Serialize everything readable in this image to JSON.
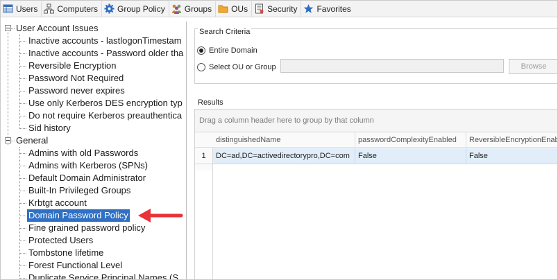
{
  "toolbar": {
    "items": [
      {
        "label": "Users",
        "icon": "users-grid-icon"
      },
      {
        "label": "Computers",
        "icon": "computers-network-icon"
      },
      {
        "label": "Group Policy",
        "icon": "gear-icon"
      },
      {
        "label": "Groups",
        "icon": "groups-icon"
      },
      {
        "label": "OUs",
        "icon": "folder-icon"
      },
      {
        "label": "Security",
        "icon": "document-icon"
      },
      {
        "label": "Favorites",
        "icon": "star-icon"
      }
    ]
  },
  "tree": {
    "groups": [
      {
        "label": "User Account Issues",
        "children": [
          "Inactive accounts - lastlogonTimestam",
          "Inactive accounts - Password older tha",
          "Reversible Encryption",
          "Password Not Required",
          "Password never expires",
          "Use only Kerberos DES encryption typ",
          "Do not require Kerberos preauthentica",
          "Sid history"
        ]
      },
      {
        "label": "General",
        "children": [
          "Admins with old Passwords",
          "Admins with Kerberos (SPNs)",
          "Default Domain Administrator",
          "Built-In Privileged Groups",
          "Krbtgt account",
          "Domain Password Policy",
          "Fine grained password policy",
          "Protected Users",
          "Tombstone lifetime",
          "Forest Functional Level",
          "Duplicate Service Principal Names (S"
        ]
      }
    ],
    "selected": "Domain Password Policy"
  },
  "search_criteria": {
    "title": "Search Criteria",
    "option_entire_domain": "Entire Domain",
    "option_select_ou": "Select OU or Group",
    "selected_option": "Entire Domain",
    "ou_value": "",
    "browse_label": "Browse"
  },
  "results": {
    "title": "Results",
    "drag_hint": "Drag a column header here to group by that column",
    "columns": [
      "distinguishedName",
      "passwordComplexityEnabled",
      "ReversibleEncryptionEnable"
    ],
    "rows": [
      {
        "num": "1",
        "cells": [
          "DC=ad,DC=activedirectorypro,DC=com",
          "False",
          "False"
        ]
      }
    ]
  },
  "colors": {
    "selection": "#2f70c4",
    "arrow": "#e8333a",
    "row_highlight": "#e1eef9"
  }
}
